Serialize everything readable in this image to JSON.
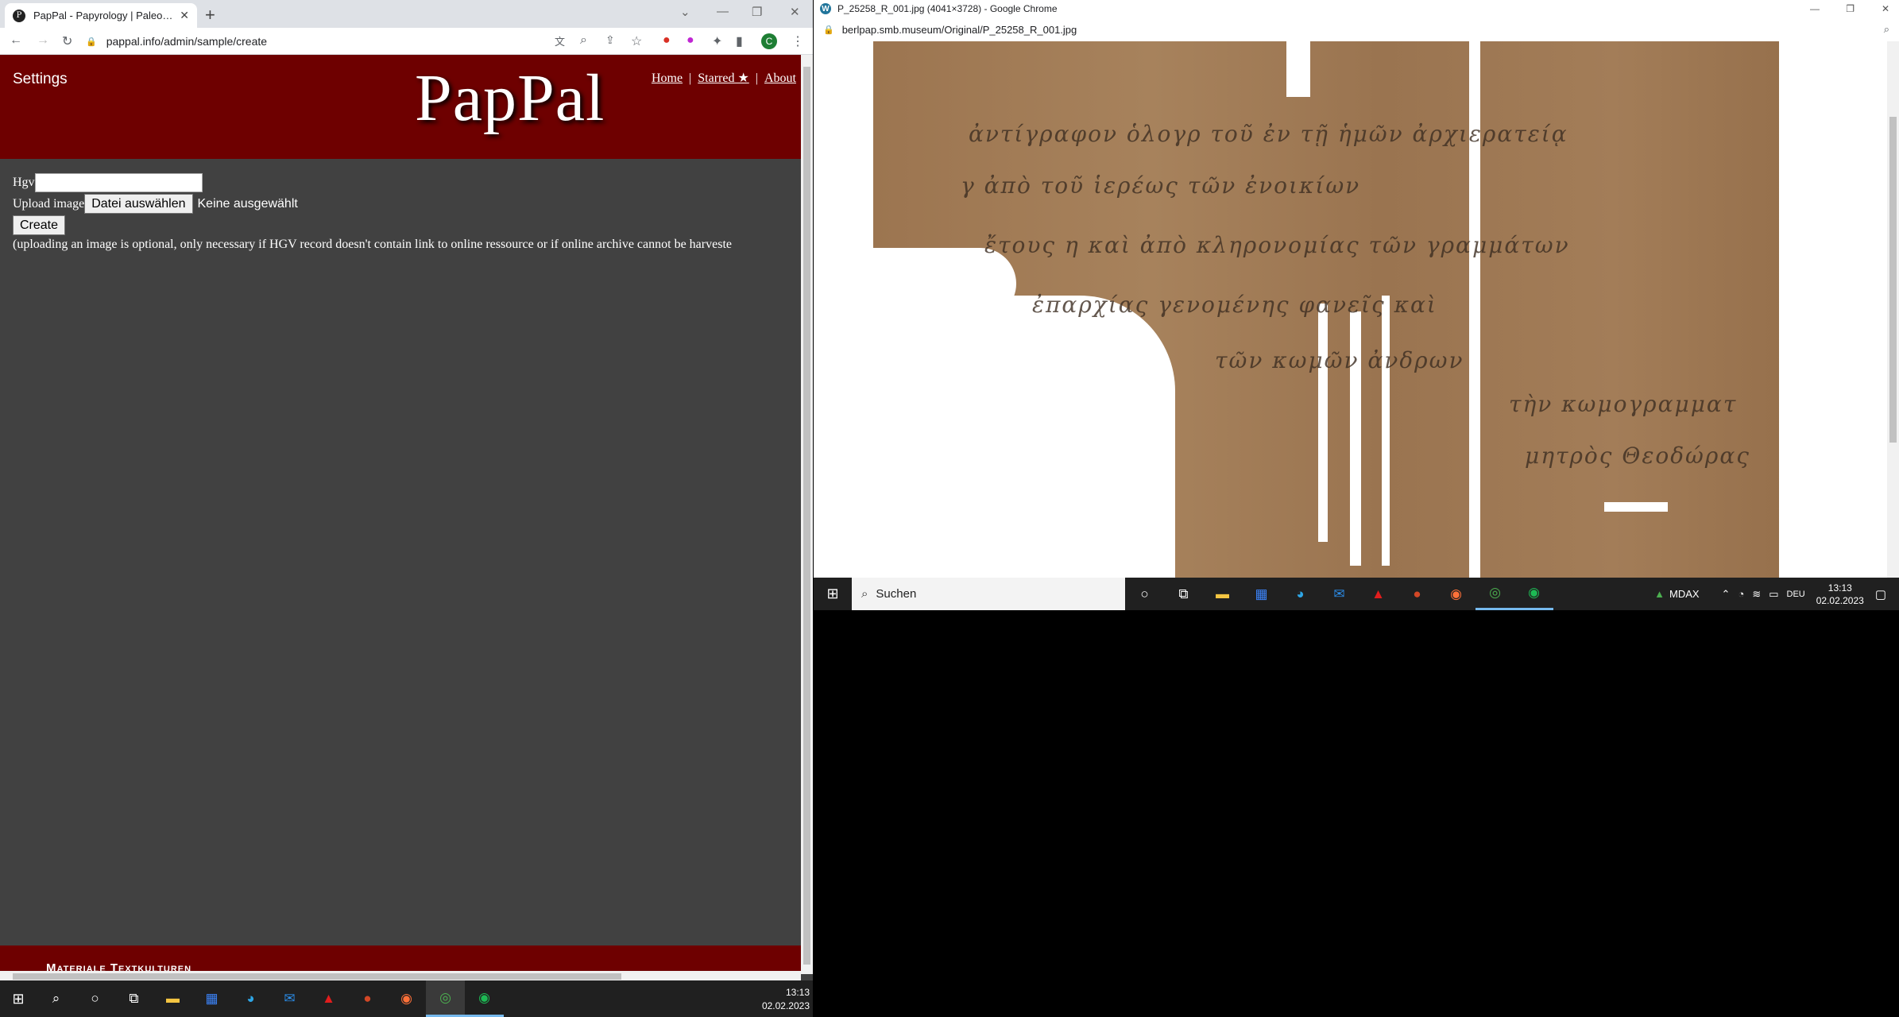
{
  "left_browser": {
    "tab_title": "PapPal - Papyrology | Paleograph",
    "url": "pappal.info/admin/sample/create",
    "profile_initial": "C",
    "page": {
      "settings_label": "Settings",
      "logo": "PapPal",
      "nav": [
        {
          "label": "Home"
        },
        {
          "label": "Starred ★"
        },
        {
          "label": "About"
        }
      ],
      "form": {
        "hgv_label": "Hgv",
        "hgv_value": "",
        "upload_label": "Upload image",
        "choose_file_button": "Datei auswählen",
        "no_file_text": "Keine ausgewählt",
        "create_button": "Create",
        "note": "(uploading an image is optional, only necessary if HGV record doesn't contain link to online ressource or if online archive cannot be harveste"
      },
      "footer_text": "Materiale Textkulturen"
    }
  },
  "right_browser": {
    "window_title": "P_25258_R_001.jpg (4041×3728) - Google Chrome",
    "url": "berlpap.smb.museum/Original/P_25258_R_001.jpg"
  },
  "right_taskbar": {
    "search_placeholder": "Suchen",
    "tray_stock": "MDAX",
    "tray_lang": "DEU",
    "time": "13:13",
    "date": "02.02.2023"
  },
  "left_taskbar": {
    "time": "13:13",
    "date": "02.02.2023"
  }
}
